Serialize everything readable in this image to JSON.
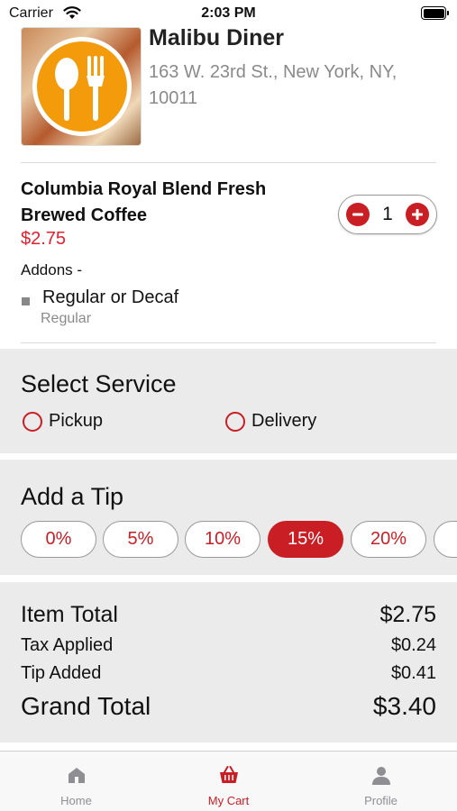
{
  "status_bar": {
    "carrier": "Carrier",
    "time": "2:03 PM"
  },
  "restaurant": {
    "name": "Malibu Diner",
    "address": "163 W. 23rd St., New York, NY, 10011",
    "logo_icon": "fork-spoon-logo",
    "logo_color": "#f49b0b"
  },
  "cart_item": {
    "name": "Columbia Royal Blend Fresh Brewed Coffee",
    "price": "$2.75",
    "quantity": "1",
    "addons_label": "Addons -",
    "addons": [
      {
        "name": "Regular or Decaf",
        "value": "Regular"
      }
    ]
  },
  "service": {
    "title": "Select Service",
    "options": [
      "Pickup",
      "Delivery"
    ]
  },
  "tip": {
    "title": "Add a Tip",
    "options": [
      "0%",
      "5%",
      "10%",
      "15%",
      "20%"
    ],
    "selected": "15%"
  },
  "totals": {
    "item_total_label": "Item Total",
    "item_total": "$2.75",
    "tax_label": "Tax Applied",
    "tax": "$0.24",
    "tip_label": "Tip Added",
    "tip": "$0.41",
    "grand_total_label": "Grand Total",
    "grand_total": "$3.40"
  },
  "tabbar": {
    "items": [
      {
        "label": "Home",
        "icon": "home-icon"
      },
      {
        "label": "My Cart",
        "icon": "cart-icon"
      },
      {
        "label": "Profile",
        "icon": "person-icon"
      }
    ],
    "active": "My Cart"
  },
  "colors": {
    "accent": "#c81e24",
    "price": "#e0212f",
    "section_bg": "#ebebeb"
  }
}
